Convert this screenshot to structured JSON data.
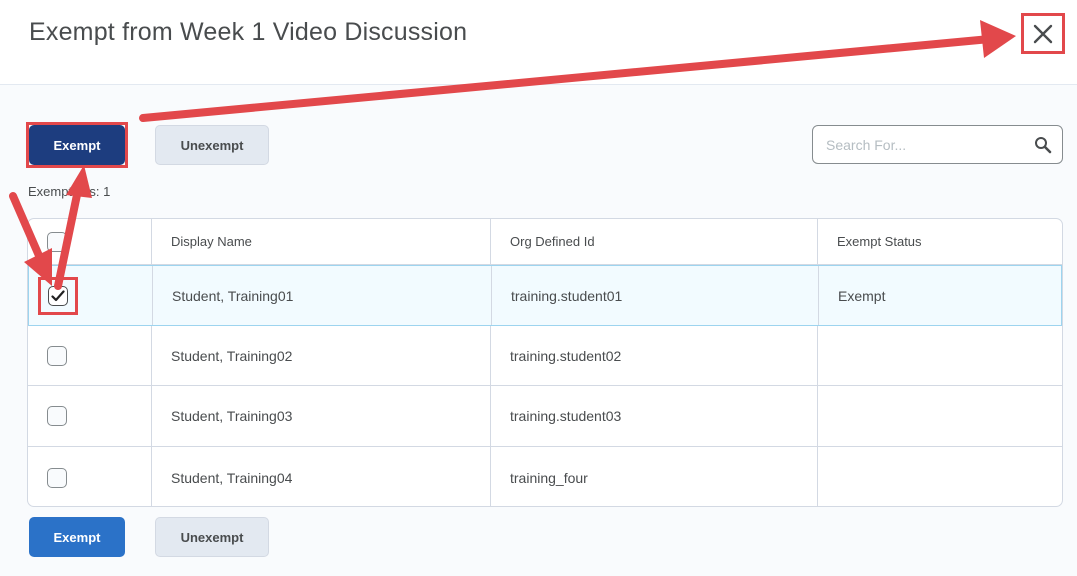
{
  "dialog": {
    "title": "Exempt from Week 1 Video Discussion",
    "close_icon": "close-icon"
  },
  "toolbar_top": {
    "exempt_label": "Exempt",
    "unexempt_label": "Unexempt"
  },
  "search": {
    "placeholder": "Search For...",
    "value": "",
    "icon": "search-icon"
  },
  "exemptions": {
    "text": "Exemptions: 1"
  },
  "table": {
    "columns": [
      "Display Name",
      "Org Defined Id",
      "Exempt Status"
    ],
    "rows": [
      {
        "checked": true,
        "display_name": "Student, Training01",
        "org_id": "training.student01",
        "status": "Exempt"
      },
      {
        "checked": false,
        "display_name": "Student, Training02",
        "org_id": "training.student02",
        "status": ""
      },
      {
        "checked": false,
        "display_name": "Student, Training03",
        "org_id": "training.student03",
        "status": ""
      },
      {
        "checked": false,
        "display_name": "Student, Training04",
        "org_id": "training_four",
        "status": ""
      }
    ]
  },
  "toolbar_bottom": {
    "exempt_label": "Exempt",
    "unexempt_label": "Unexempt"
  },
  "colors": {
    "primary": "#2b72c8",
    "primary_active": "#1d3d7f",
    "annotation": "#e2484b",
    "selected_row": "#f2fbff"
  }
}
